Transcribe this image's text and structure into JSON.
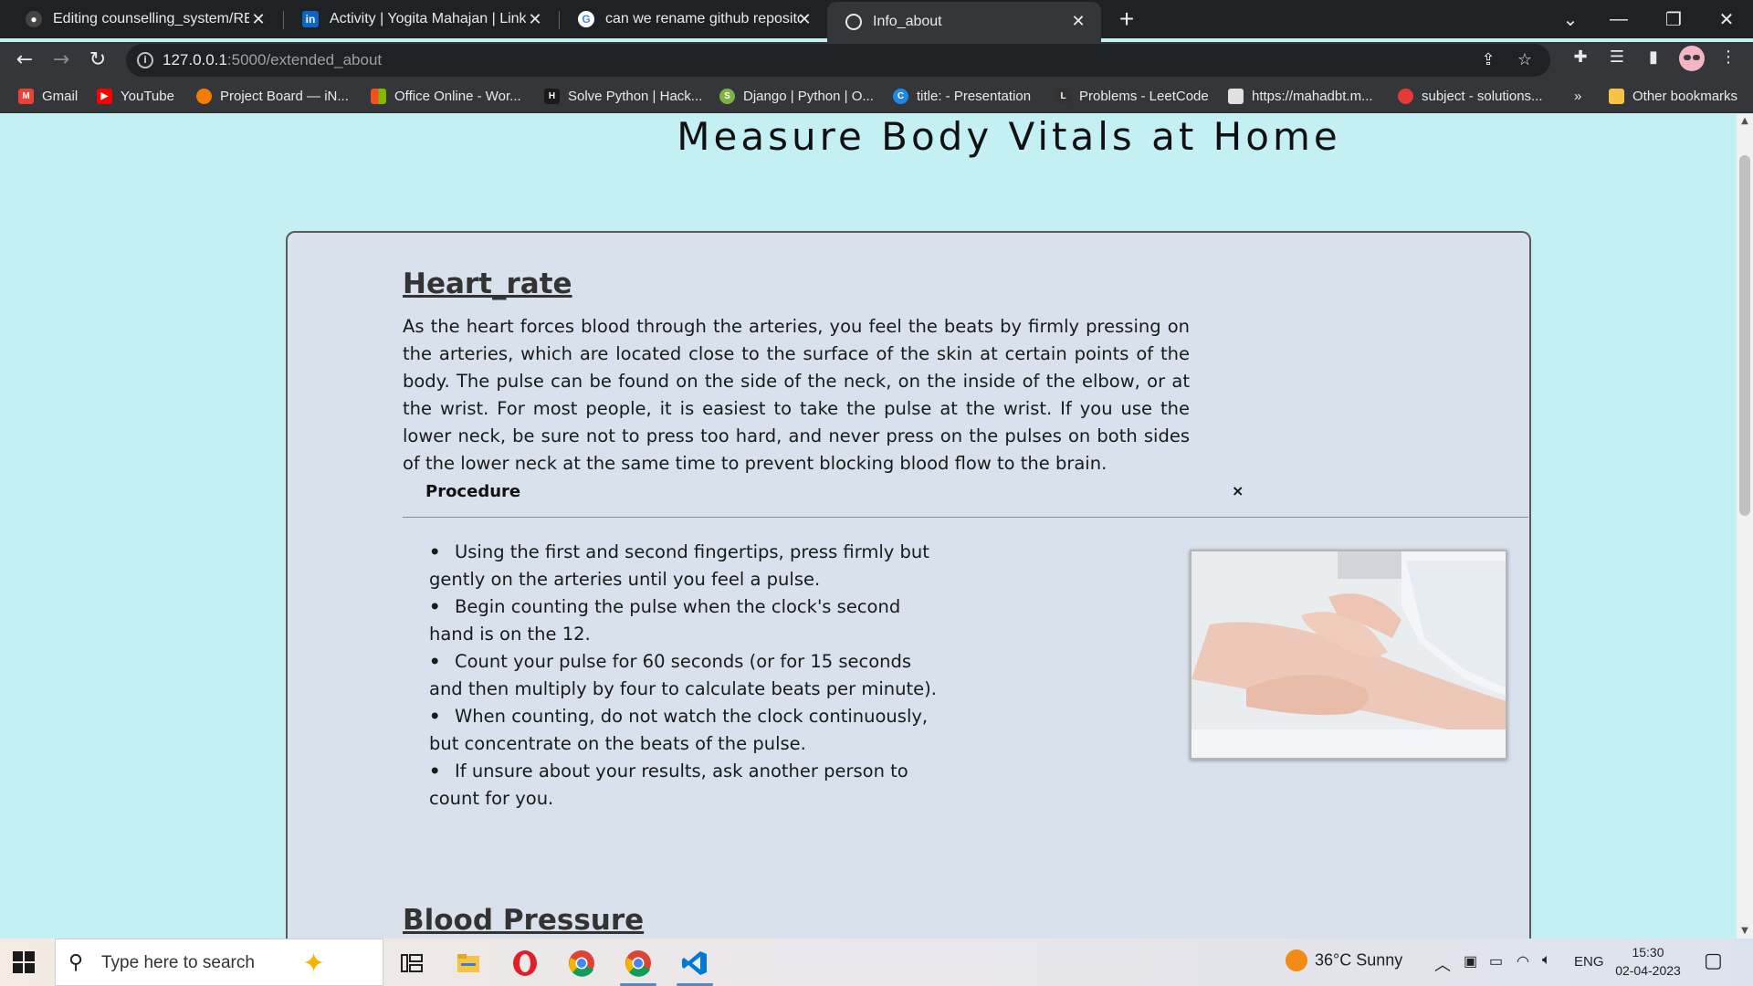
{
  "browser": {
    "tabs": [
      {
        "title": "Editing counselling_system/READ",
        "icon": "github-icon"
      },
      {
        "title": "Activity | Yogita Mahajan | Linked",
        "icon": "linkedin-icon"
      },
      {
        "title": "can we rename github repository",
        "icon": "google-icon"
      },
      {
        "title": "Info_about",
        "icon": "globe-icon"
      }
    ],
    "url_host": "127.0.0.1",
    "url_path": ":5000/extended_about",
    "bookmarks": [
      {
        "label": "Gmail",
        "color": "#ea4335"
      },
      {
        "label": "YouTube",
        "color": "#ff0000"
      },
      {
        "label": "Project Board — iN...",
        "color": "#f57c00"
      },
      {
        "label": "Office Online - Wor...",
        "color": "#f25022"
      },
      {
        "label": "Solve Python | Hack...",
        "color": "#1a1a1a"
      },
      {
        "label": "Django | Python | O...",
        "color": "#7cb342"
      },
      {
        "label": "title: - Presentation",
        "color": "#1e88e5"
      },
      {
        "label": "Problems - LeetCode",
        "color": "#333333"
      },
      {
        "label": "https://mahadbt.m...",
        "color": "#e0e0e0"
      },
      {
        "label": "subject - solutions...",
        "color": "#e53935"
      }
    ],
    "overflow_label": "»",
    "other_bookmarks": "Other bookmarks"
  },
  "page": {
    "title": "Measure Body Vitals at Home",
    "section1": {
      "heading": "Heart_rate",
      "paragraph": "As the heart forces blood through the arteries, you feel the beats by firmly pressing on the arteries, which are located close to the surface of the skin at certain points of the body. The pulse can be found on the side of the neck, on the inside of the elbow, or at the wrist. For most people, it is easiest to take the pulse at the wrist. If you use the lower neck, be sure not to press too hard, and never press on the pulses on both sides of the lower neck at the same time to prevent blocking blood flow to the brain.",
      "procedure_label": "Procedure",
      "close_symbol": "×",
      "steps": [
        "Using the first and second fingertips, press firmly but gently on the arteries until you feel a pulse.",
        "Begin counting the pulse when the clock's second hand is on the 12.",
        "Count your pulse for 60 seconds (or for 15 seconds and then multiply by four to calculate beats per minute).",
        "When counting, do not watch the clock continuously, but concentrate on the beats of the pulse.",
        "If unsure about your results, ask another person to count for you."
      ],
      "bullet": "•"
    },
    "section2": {
      "heading": "Blood Pressure"
    }
  },
  "taskbar": {
    "search_placeholder": "Type here to search",
    "weather": "36°C  Sunny",
    "language": "ENG",
    "time": "15:30",
    "date": "02-04-2023"
  },
  "colors": {
    "page_bg": "#c4eff3",
    "card_bg": "#d8e1ec",
    "browser_dark": "#202124",
    "toolbar": "#35363a"
  }
}
